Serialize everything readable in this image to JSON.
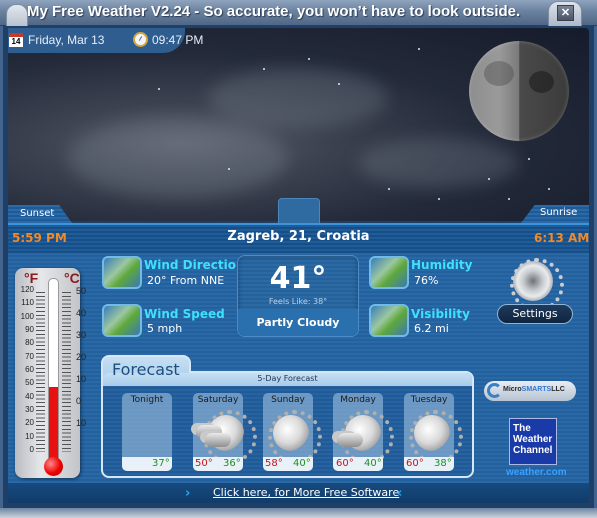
{
  "window": {
    "title": "My Free Weather V2.24 -  So accurate, you won’t have to look outside.",
    "close_label": "✕"
  },
  "header": {
    "date": "Friday, Mar 13",
    "calendar_day": "14",
    "time": "09:47 PM"
  },
  "sun": {
    "sunset_label": "Sunset",
    "sunset_time": "5:59 PM",
    "sunrise_label": "Sunrise",
    "sunrise_time": "6:13 AM"
  },
  "location": "Zagreb, 21, Croatia",
  "moon": {
    "phase": "last-quarter"
  },
  "thermometer": {
    "f_label": "°F",
    "c_label": "°C",
    "f_ticks": [
      "120",
      "110",
      "100",
      "90",
      "80",
      "70",
      "60",
      "50",
      "40",
      "30",
      "20",
      "10",
      "0"
    ],
    "c_ticks": [
      "50",
      "40",
      "30",
      "20",
      "10",
      "0",
      "10"
    ],
    "current_f": 41,
    "range_f": [
      0,
      120
    ]
  },
  "stats": {
    "wind_direction": {
      "label": "Wind Direction",
      "value": "20° From NNE",
      "icon": "wind-icon"
    },
    "wind_speed": {
      "label": "Wind Speed",
      "value": "5 mph",
      "icon": "wind-icon"
    },
    "humidity": {
      "label": "Humidity",
      "value": "76%",
      "icon": "leaf-drops-icon"
    },
    "visibility": {
      "label": "Visibility",
      "value": "6.2 mi",
      "icon": "leaf-icon"
    }
  },
  "current": {
    "temp": "41°",
    "feels_like": "Feels Like: 38°",
    "condition": "Partly Cloudy"
  },
  "settings_label": "Settings",
  "forecast": {
    "title": "Forecast",
    "subtitle": "5-Day Forecast",
    "days": [
      {
        "name": "Tonight",
        "hi": "",
        "lo": "37°",
        "icon": "none"
      },
      {
        "name": "Saturday",
        "hi": "50°",
        "lo": "36°",
        "icon": "partly-cloudy-icon"
      },
      {
        "name": "Sunday",
        "hi": "58°",
        "lo": "40°",
        "icon": "sunny-hazy-icon"
      },
      {
        "name": "Monday",
        "hi": "60°",
        "lo": "40°",
        "icon": "partly-cloudy-icon"
      },
      {
        "name": "Tuesday",
        "hi": "60°",
        "lo": "38°",
        "icon": "sunny-icon"
      }
    ]
  },
  "branding": {
    "microsmarts_prefix": "Micro",
    "microsmarts_mid": "SMARTS",
    "microsmarts_suffix": "LLC",
    "twc_line1": "The",
    "twc_line2": "Weather",
    "twc_line3": "Channel",
    "twc_site": "weather.com"
  },
  "footer": {
    "link_text": "Click here, for More Free Software",
    "arrow_right": "›",
    "arrow_left": "‹"
  },
  "colors": {
    "accent_cyan": "#3fe0ff",
    "sun_time_orange": "#f08a2a",
    "high_temp_red": "#d0101a",
    "low_temp_green": "#1f8f1f"
  }
}
